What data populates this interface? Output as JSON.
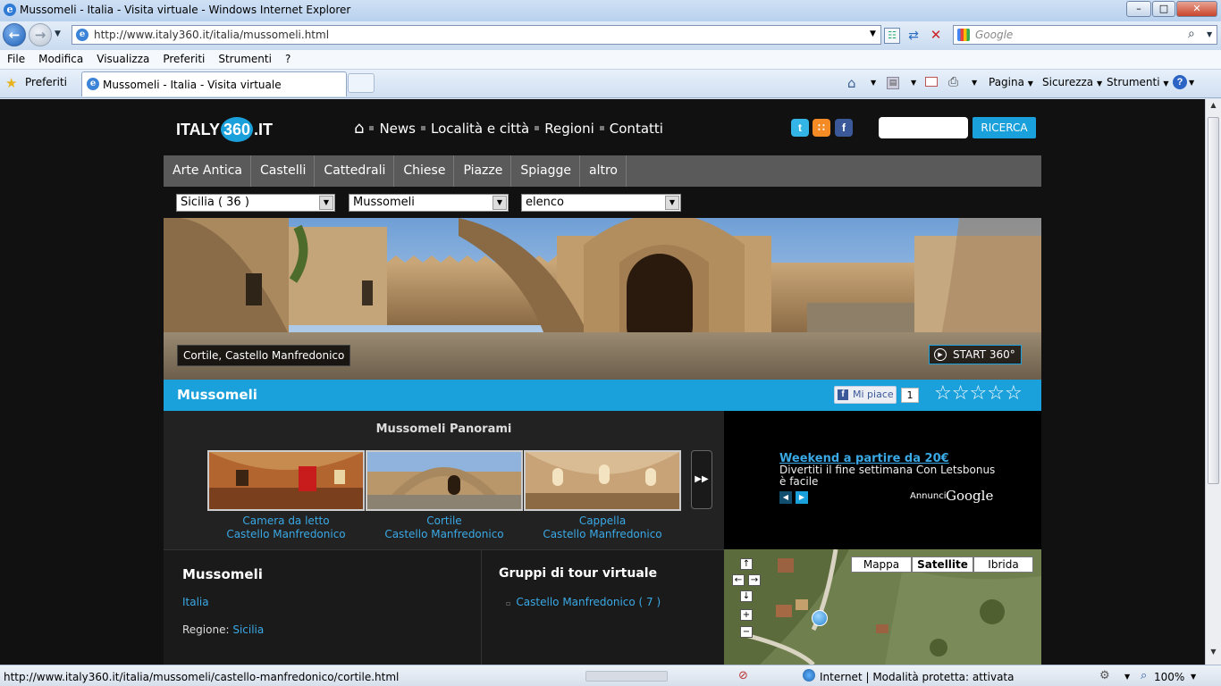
{
  "window": {
    "title": "Mussomeli - Italia - Visita virtuale - Windows Internet Explorer"
  },
  "address": {
    "url": "http://www.italy360.it/italia/mussomeli.html",
    "search_placeholder": "Google"
  },
  "menu": [
    "File",
    "Modifica",
    "Visualizza",
    "Preferiti",
    "Strumenti",
    "?"
  ],
  "favorites_label": "Preferiti",
  "tab": {
    "title": "Mussomeli - Italia - Visita virtuale"
  },
  "commandbar": {
    "pagina": "Pagina",
    "sicurezza": "Sicurezza",
    "strumenti": "Strumenti"
  },
  "site": {
    "logo": {
      "pre": "ITALY",
      "mid": "360",
      "post": ".IT"
    },
    "nav": [
      "News",
      "Località e città",
      "Regioni",
      "Contatti"
    ],
    "search_button": "RICERCA",
    "categories": [
      "Arte Antica",
      "Castelli",
      "Cattedrali",
      "Chiese",
      "Piazze",
      "Spiagge",
      "altro"
    ],
    "selects": {
      "region": "Sicilia ( 36 )",
      "city": "Mussomeli",
      "view": "elenco"
    },
    "hero": {
      "caption": "Cortile, Castello Manfredonico",
      "start_button": "START 360°"
    },
    "place_title": "Mussomeli",
    "like": {
      "label": "Mi piace",
      "count": "1"
    },
    "rating": {
      "stars": 5,
      "filled": 0
    },
    "panorami": {
      "title": "Mussomeli Panorami",
      "items": [
        {
          "name": "Camera da letto",
          "place": "Castello Manfredonico"
        },
        {
          "name": "Cortile",
          "place": "Castello Manfredonico"
        },
        {
          "name": "Cappella",
          "place": "Castello Manfredonico"
        }
      ]
    },
    "ad": {
      "title": "Weekend a partire da 20€",
      "line1": "Divertiti il fine settimana Con Letsbonus",
      "line2": "è facile",
      "annunci": "Annunci",
      "google": "Google"
    },
    "info": {
      "title": "Mussomeli",
      "country": "Italia",
      "region_label": "Regione:",
      "region": "Sicilia"
    },
    "gruppi": {
      "title": "Gruppi di tour virtuale",
      "items": [
        "Castello Manfredonico ( 7 )"
      ]
    },
    "map": {
      "buttons": [
        "Mappa",
        "Satellite",
        "Ibrida"
      ],
      "active": "Satellite"
    }
  },
  "status": {
    "url": "http://www.italy360.it/italia/mussomeli/castello-manfredonico/cortile.html",
    "zone": "Internet | Modalità protetta: attivata",
    "zoom": "100%"
  },
  "colors": {
    "accent": "#1aa0db",
    "link": "#3aa9e6",
    "page_bg": "#111111"
  }
}
